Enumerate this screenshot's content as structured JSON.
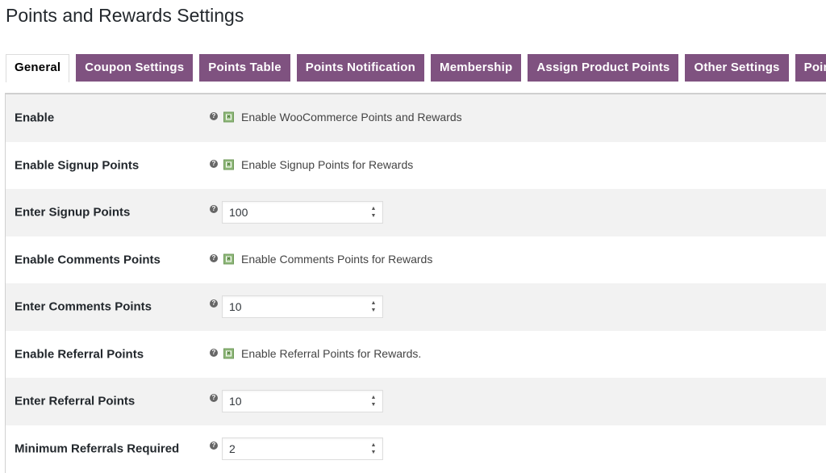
{
  "page": {
    "title": "Points and Rewards Settings"
  },
  "tabs": [
    {
      "label": "General",
      "active": true
    },
    {
      "label": "Coupon Settings",
      "active": false
    },
    {
      "label": "Points Table",
      "active": false
    },
    {
      "label": "Points Notification",
      "active": false
    },
    {
      "label": "Membership",
      "active": false
    },
    {
      "label": "Assign Product Points",
      "active": false
    },
    {
      "label": "Other Settings",
      "active": false
    },
    {
      "label": "Points Exp",
      "active": false
    }
  ],
  "settings": {
    "enable": {
      "label": "Enable",
      "checkbox_label": "Enable WooCommerce Points and Rewards",
      "checked": true
    },
    "enable_signup": {
      "label": "Enable Signup Points",
      "checkbox_label": "Enable Signup Points for Rewards",
      "checked": true
    },
    "signup_points": {
      "label": "Enter Signup Points",
      "value": "100"
    },
    "enable_comments": {
      "label": "Enable Comments Points",
      "checkbox_label": "Enable Comments Points for Rewards",
      "checked": true
    },
    "comments_points": {
      "label": "Enter Comments Points",
      "value": "10"
    },
    "enable_referral": {
      "label": "Enable Referral Points",
      "checkbox_label": "Enable Referral Points for Rewards.",
      "checked": true
    },
    "referral_points": {
      "label": "Enter Referral Points",
      "value": "10"
    },
    "min_referrals": {
      "label": "Minimum Referrals Required",
      "value": "2"
    }
  },
  "icons": {
    "help": "?",
    "spinner_up": "▲",
    "spinner_down": "▼",
    "check": "×"
  }
}
